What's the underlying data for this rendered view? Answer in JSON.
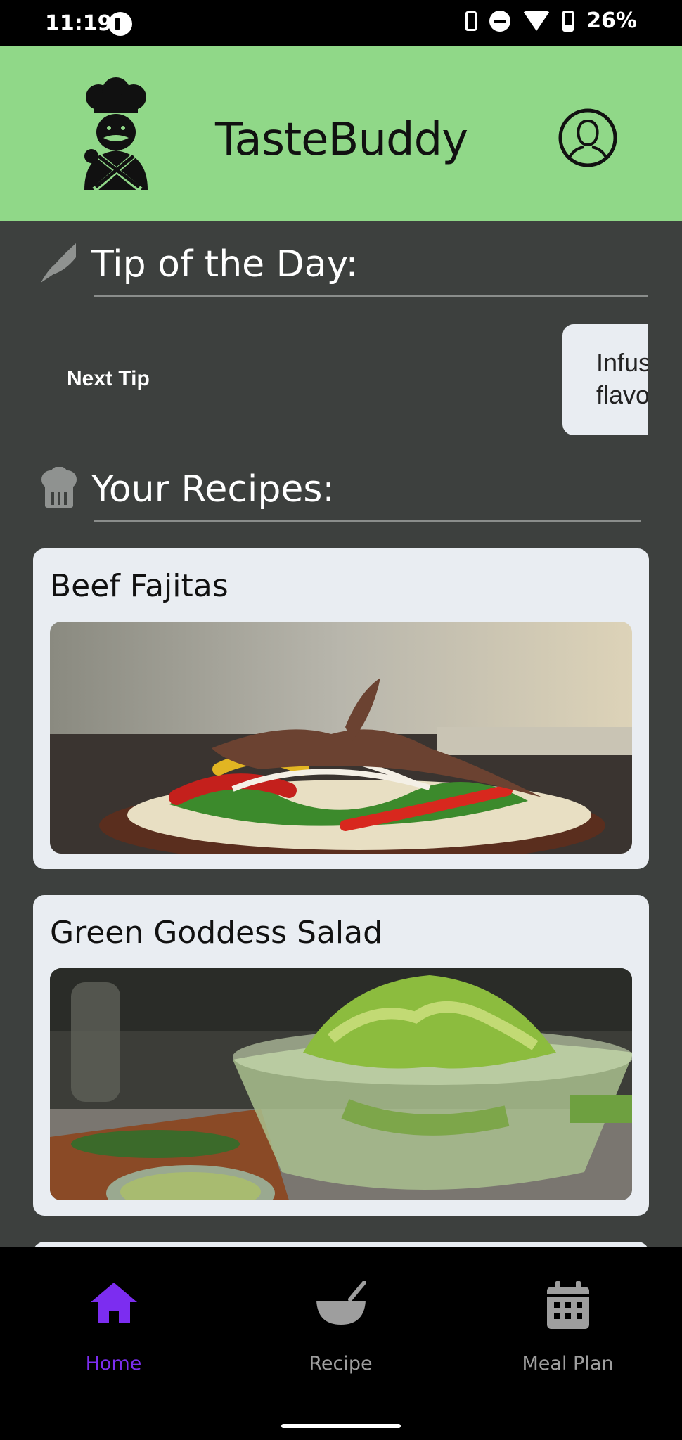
{
  "status_bar": {
    "time": "11:19",
    "battery_percent": "26%",
    "icons": [
      "app-notification-icon",
      "vibrate-icon",
      "do-not-disturb-icon",
      "wifi-icon",
      "battery-charging-icon"
    ]
  },
  "header": {
    "title": "TasteBuddy",
    "logo_icon": "chef-logo-icon",
    "profile_icon": "profile-icon",
    "background": "#90d888"
  },
  "tip_section": {
    "title": "Tip of the Day:",
    "icon": "knife-icon",
    "next_tip_label": "Next Tip",
    "tip_text": "Infus\nflavo"
  },
  "recipes_section": {
    "title": "Your Recipes:",
    "icon": "chef-hat-icon",
    "recipes": [
      {
        "title": "Beef Fajitas"
      },
      {
        "title": "Green Goddess Salad"
      }
    ]
  },
  "bottom_nav": {
    "items": [
      {
        "label": "Home",
        "icon": "home-icon",
        "active": true,
        "color": "#7c2df0"
      },
      {
        "label": "Recipe",
        "icon": "bowl-icon",
        "active": false,
        "color": "#9e9e9e"
      },
      {
        "label": "Meal Plan",
        "icon": "calendar-icon",
        "active": false,
        "color": "#9e9e9e"
      }
    ]
  }
}
